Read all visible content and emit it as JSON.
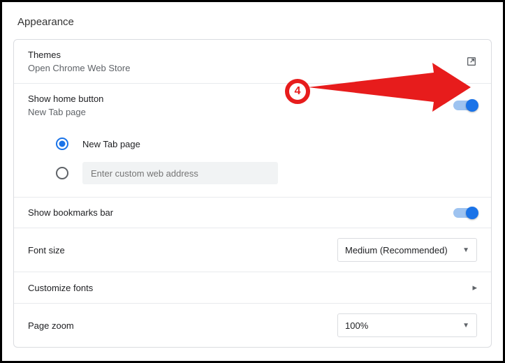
{
  "section_title": "Appearance",
  "themes": {
    "title": "Themes",
    "subtitle": "Open Chrome Web Store"
  },
  "home": {
    "title": "Show home button",
    "subtitle": "New Tab page",
    "option_newtab": "New Tab page",
    "custom_placeholder": "Enter custom web address"
  },
  "bookmarks": {
    "title": "Show bookmarks bar"
  },
  "fontsize": {
    "title": "Font size",
    "value": "Medium (Recommended)"
  },
  "customfonts": {
    "title": "Customize fonts"
  },
  "zoom": {
    "title": "Page zoom",
    "value": "100%"
  },
  "callout": {
    "number": "4"
  }
}
